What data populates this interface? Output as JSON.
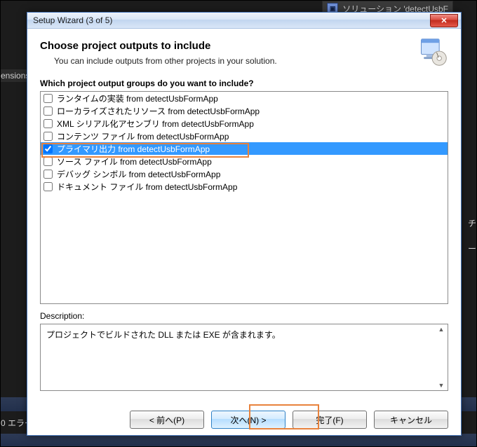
{
  "background": {
    "left_panel_label": "ensions",
    "bottom_left_label": "0 エラー",
    "solution_explorer_label": "ソリューション 'detectUsbF",
    "right_tab_labels": [
      "チ",
      "ー"
    ]
  },
  "dialog": {
    "title": "Setup Wizard (3 of 5)",
    "header": "Choose project outputs to include",
    "subheader": "You can include outputs from other projects in your solution.",
    "question": "Which project output groups do you want to include?",
    "items": [
      {
        "label": "ランタイムの実装 from detectUsbFormApp",
        "checked": false,
        "selected": false
      },
      {
        "label": "ローカライズされたリソース from detectUsbFormApp",
        "checked": false,
        "selected": false
      },
      {
        "label": "XML シリアル化アセンブリ from detectUsbFormApp",
        "checked": false,
        "selected": false
      },
      {
        "label": "コンテンツ ファイル from detectUsbFormApp",
        "checked": false,
        "selected": false
      },
      {
        "label": "プライマリ出力 from detectUsbFormApp",
        "checked": true,
        "selected": true
      },
      {
        "label": "ソース ファイル from detectUsbFormApp",
        "checked": false,
        "selected": false
      },
      {
        "label": "デバッグ シンボル from detectUsbFormApp",
        "checked": false,
        "selected": false
      },
      {
        "label": "ドキュメント ファイル from detectUsbFormApp",
        "checked": false,
        "selected": false
      }
    ],
    "description_label": "Description:",
    "description_text": "プロジェクトでビルドされた DLL または EXE が含まれます。",
    "buttons": {
      "back": "< 前へ(P)",
      "next": "次へ(N) >",
      "finish": "完了(F)",
      "cancel": "キャンセル"
    }
  }
}
